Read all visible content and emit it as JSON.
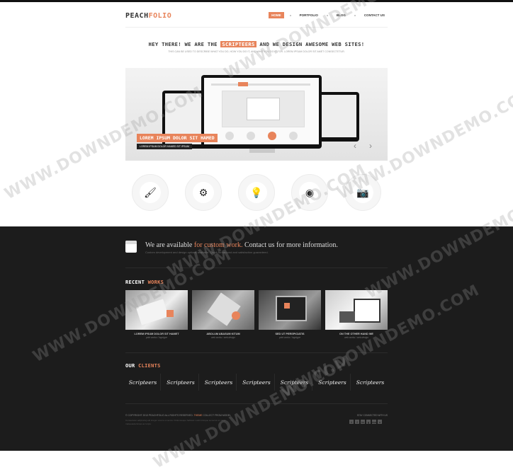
{
  "header": {
    "logo_prefix": "PEACH",
    "logo_suffix": "FOLIO",
    "nav": [
      "HOME",
      "PORTFOLIO",
      "BLOG",
      "CONTACT US"
    ]
  },
  "intro": {
    "headline_pre": "HEY THERE! WE ARE THE",
    "headline_highlight": "SCRIPTEERS",
    "headline_post": "AND WE DESIGN AWESOME WEB SITES!",
    "subline": "THIS CAN BE USED TO DESCRIBE WHAT YOU DO, HOW YOU DO IT, AND WHO YOU DO IT FOR. LOREM IPSUM DOLOR SIT AMET CONSECTETUR."
  },
  "slider": {
    "caption": "LOREM IPSUM DOLOR SIT HAMED",
    "caption_sub": "LOREM IPSUM DOLOR HAMED SIT IPSUM",
    "prev_label": "‹",
    "next_label": "›"
  },
  "features": [
    {
      "icon": "brush-icon",
      "glyph": "🖌"
    },
    {
      "icon": "gear-icon",
      "glyph": "⚙"
    },
    {
      "icon": "lightbulb-icon",
      "glyph": "💡"
    },
    {
      "icon": "film-reel-icon",
      "glyph": "◉"
    },
    {
      "icon": "camera-icon",
      "glyph": "📷"
    }
  ],
  "availability": {
    "title_pre": "We are available",
    "title_mid": "for custom work.",
    "title_post": "Contact us for more information.",
    "sub": "Custom development and design options available. Quick turnaround and satisfaction guaranteed."
  },
  "recent_works": {
    "title_pre": "RECENT",
    "title_accent": "WORKS",
    "items": [
      {
        "title": "LOREM IPSUM DOLOR SIT HAMET",
        "sub": "print works / logotype"
      },
      {
        "title": "ABOLUM ABASUM KITUM",
        "sub": "web works / web design"
      },
      {
        "title": "SED UT PERSPICIATIS",
        "sub": "print works / logotype"
      },
      {
        "title": "ON THE OTHER HAND WE",
        "sub": "web works / web design"
      }
    ]
  },
  "clients": {
    "title_pre": "OUR",
    "title_accent": "CLIENTS",
    "items": [
      "Scripteers",
      "Scripteers",
      "Scripteers",
      "Scripteers",
      "Scripteers",
      "Scripteers",
      "Scripteers"
    ]
  },
  "footer": {
    "copyright_pre": "© COPYRIGHT 2013 PEACHFOLIO ALL RIGHTS RESERVED.",
    "copyright_accent": "THEME",
    "copyright_post": "COLLECT FROM MODEL",
    "fine": "Consectetur adipiscing elit integer viverra ut lectus. Pellentesque habitant morbi tristique senectus et netus malesuada fames ac turpis.",
    "stay": "STAY CONNECTED WITH US",
    "social": [
      "t",
      "f",
      "in",
      "g",
      "rss",
      "v"
    ]
  },
  "watermark": "WWW.DOWNDEMO.COM",
  "colors": {
    "accent": "#e8845b",
    "dark_bg": "#1c1c1c"
  }
}
